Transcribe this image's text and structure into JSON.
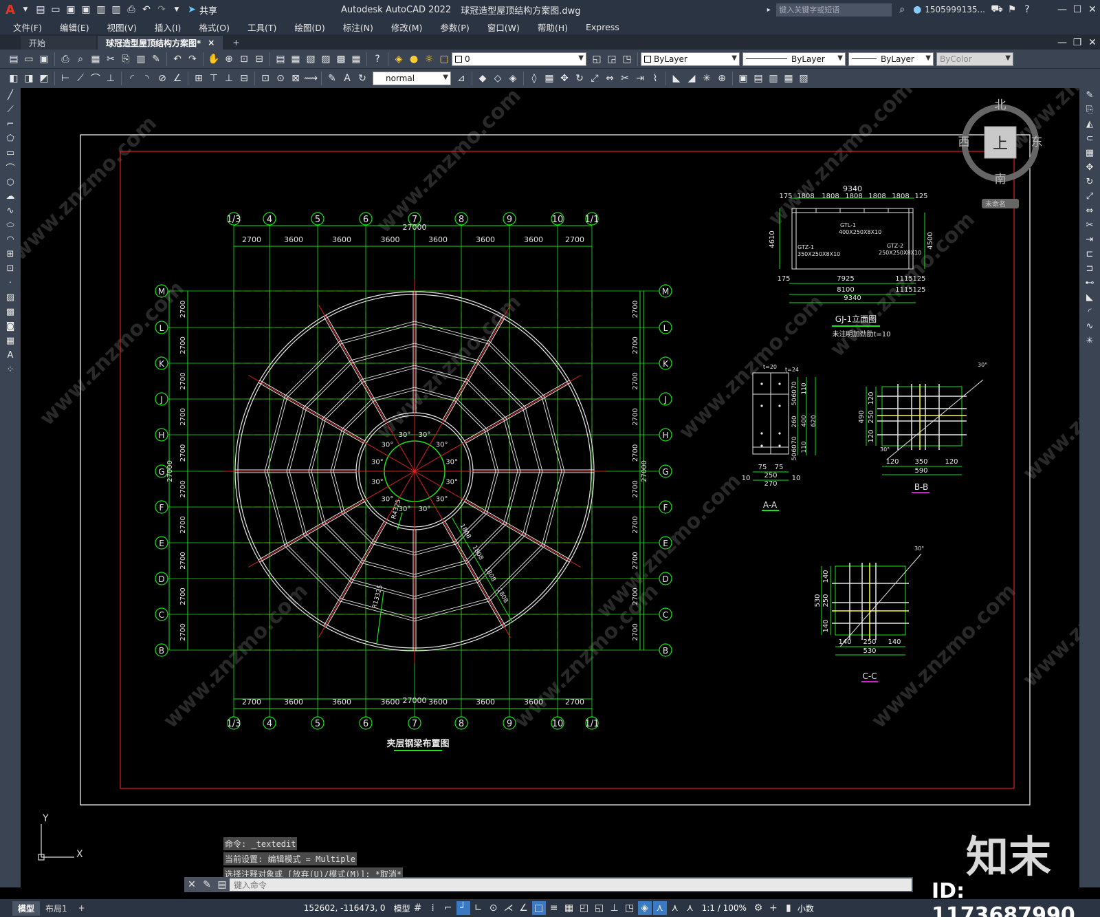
{
  "app": {
    "title": "Autodesk AutoCAD 2022",
    "file": "球冠造型屋顶结构方案图.dwg",
    "share": "共享",
    "search_placeholder": "键入关键字或短语",
    "user": "1505999135...",
    "logo": "A"
  },
  "menu": [
    "文件(F)",
    "编辑(E)",
    "视图(V)",
    "插入(I)",
    "格式(O)",
    "工具(T)",
    "绘图(D)",
    "标注(N)",
    "修改(M)",
    "参数(P)",
    "窗口(W)",
    "帮助(H)",
    "Express"
  ],
  "tabs": {
    "start": "开始",
    "active": "球冠造型屋顶结构方案图*",
    "close": "×",
    "add": "+"
  },
  "toolbar": {
    "layer": "0",
    "style": "normal",
    "color": "ByLayer",
    "linetype": "ByLayer",
    "lineweight": "ByLayer",
    "plotstyle": "ByColor"
  },
  "viewcube": {
    "north": "北",
    "south": "南",
    "east": "东",
    "west": "西",
    "top": "上",
    "wcs": "未命名"
  },
  "drawing": {
    "main_title": "夹层钢梁布置图",
    "total": "27000",
    "col_labels": [
      "1/3",
      "4",
      "5",
      "6",
      "7",
      "8",
      "9",
      "10",
      "1/1"
    ],
    "col_dims": [
      "2700",
      "3600",
      "3600",
      "3600",
      "3600",
      "3600",
      "3600",
      "2700"
    ],
    "row_labels": [
      "M",
      "L",
      "K",
      "J",
      "H",
      "G",
      "F",
      "E",
      "D",
      "C",
      "B"
    ],
    "row_dim": "2700",
    "angle": "30°",
    "radius_inner": "R4325",
    "radius_outer": "R13325",
    "radial_dim": "1808",
    "gj_title": "GJ-1立面图",
    "gj_note": "未注明加劲肋t=10",
    "gj_top_total": "9340",
    "gj_top_dims": [
      "175",
      "1808",
      "1808",
      "1808",
      "1808",
      "1808",
      "125"
    ],
    "gj_height_left": "4610",
    "gj_height_right": "4500",
    "gj_beam": "GTL-1",
    "gj_beam_size": "400X250X8X10",
    "gj_col1": "GTZ-1",
    "gj_col1_size": "350X250X8X10",
    "gj_col2": "GTZ-2",
    "gj_col2_size": "250X250X8X10",
    "gj_bottom": [
      "175",
      "7925",
      "1115",
      "125",
      "8100",
      "1115",
      "125",
      "9340"
    ],
    "aa_title": "A-A",
    "aa_dims": [
      "75",
      "75",
      "250",
      "270",
      "10",
      "10"
    ],
    "aa_vdims": [
      "70",
      "60",
      "50",
      "110",
      "260",
      "400",
      "620",
      "70",
      "60",
      "50",
      "110"
    ],
    "aa_top": [
      "t=20",
      "t=24"
    ],
    "bb_title": "B-B",
    "bb_dims": [
      "120",
      "350",
      "120",
      "590"
    ],
    "bb_vdims": [
      "120",
      "250",
      "120",
      "490"
    ],
    "cc_title": "C-C",
    "cc_dims": [
      "140",
      "250",
      "140",
      "530"
    ],
    "cc_vdims": [
      "140",
      "250",
      "140",
      "530"
    ],
    "weld_angle": "30°"
  },
  "ucs": {
    "y": "Y",
    "x": "X"
  },
  "command": {
    "history": [
      "命令: _textedit",
      "当前设置: 编辑模式 = Multiple",
      "选择注释对象或 [放弃(U)/模式(M)]: *取消*"
    ],
    "placeholder": "键入命令"
  },
  "status": {
    "model_tab": "模型",
    "layout_tab": "布局1",
    "add": "+",
    "coords": "152602, -116473, 0",
    "space": "模型",
    "scale": "1:1 / 100%",
    "units": "小数"
  },
  "watermark": {
    "brand": "知末",
    "id": "ID: 1173687990",
    "site": "www.znzmo.com"
  }
}
